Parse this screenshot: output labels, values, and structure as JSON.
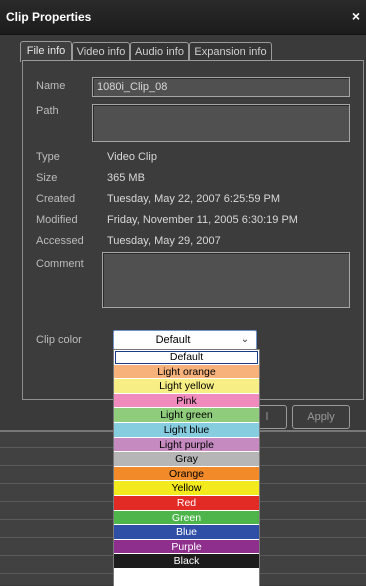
{
  "window": {
    "title": "Clip Properties",
    "close_glyph": "×",
    "close_icon": "close-icon"
  },
  "tabs": [
    {
      "label": "File info",
      "active": true
    },
    {
      "label": "Video info",
      "active": false
    },
    {
      "label": "Audio info",
      "active": false
    },
    {
      "label": "Expansion info",
      "active": false
    }
  ],
  "fields": {
    "name_label": "Name",
    "name_value": "1080i_Clip_08",
    "path_label": "Path",
    "path_value": "",
    "type_label": "Type",
    "type_value": "Video Clip",
    "size_label": "Size",
    "size_value": "365 MB",
    "created_label": "Created",
    "created_value": "Tuesday, May 22, 2007 6:25:59 PM",
    "modified_label": "Modified",
    "modified_value": "Friday, November 11, 2005 6:30:19 PM",
    "accessed_label": "Accessed",
    "accessed_value": "Tuesday, May 29, 2007",
    "comment_label": "Comment",
    "comment_value": "",
    "clip_color_label": "Clip color",
    "clip_color_value": "Default",
    "dropdown_arrow": "⌄"
  },
  "buttons": {
    "cancel_label_partial": "l",
    "apply_label": "Apply"
  },
  "clip_color_options": [
    {
      "label": "Default",
      "color": "#ffffff",
      "selected": true
    },
    {
      "label": "Light orange",
      "color": "#f6b27a"
    },
    {
      "label": "Light yellow",
      "color": "#f7ef86"
    },
    {
      "label": "Pink",
      "color": "#f08bbd"
    },
    {
      "label": "Light green",
      "color": "#8fcc7c"
    },
    {
      "label": "Light blue",
      "color": "#86cde0"
    },
    {
      "label": "Light purple",
      "color": "#c58ac0"
    },
    {
      "label": "Gray",
      "color": "#b6b6b6"
    },
    {
      "label": "Orange",
      "color": "#f28a2a"
    },
    {
      "label": "Yellow",
      "color": "#f3ea1e"
    },
    {
      "label": "Red",
      "color": "#e32b25"
    },
    {
      "label": "Green",
      "color": "#4db54a"
    },
    {
      "label": "Blue",
      "color": "#2f4fa7"
    },
    {
      "label": "Purple",
      "color": "#8e2f8e"
    },
    {
      "label": "Black",
      "color": "#1c1c1c"
    }
  ]
}
